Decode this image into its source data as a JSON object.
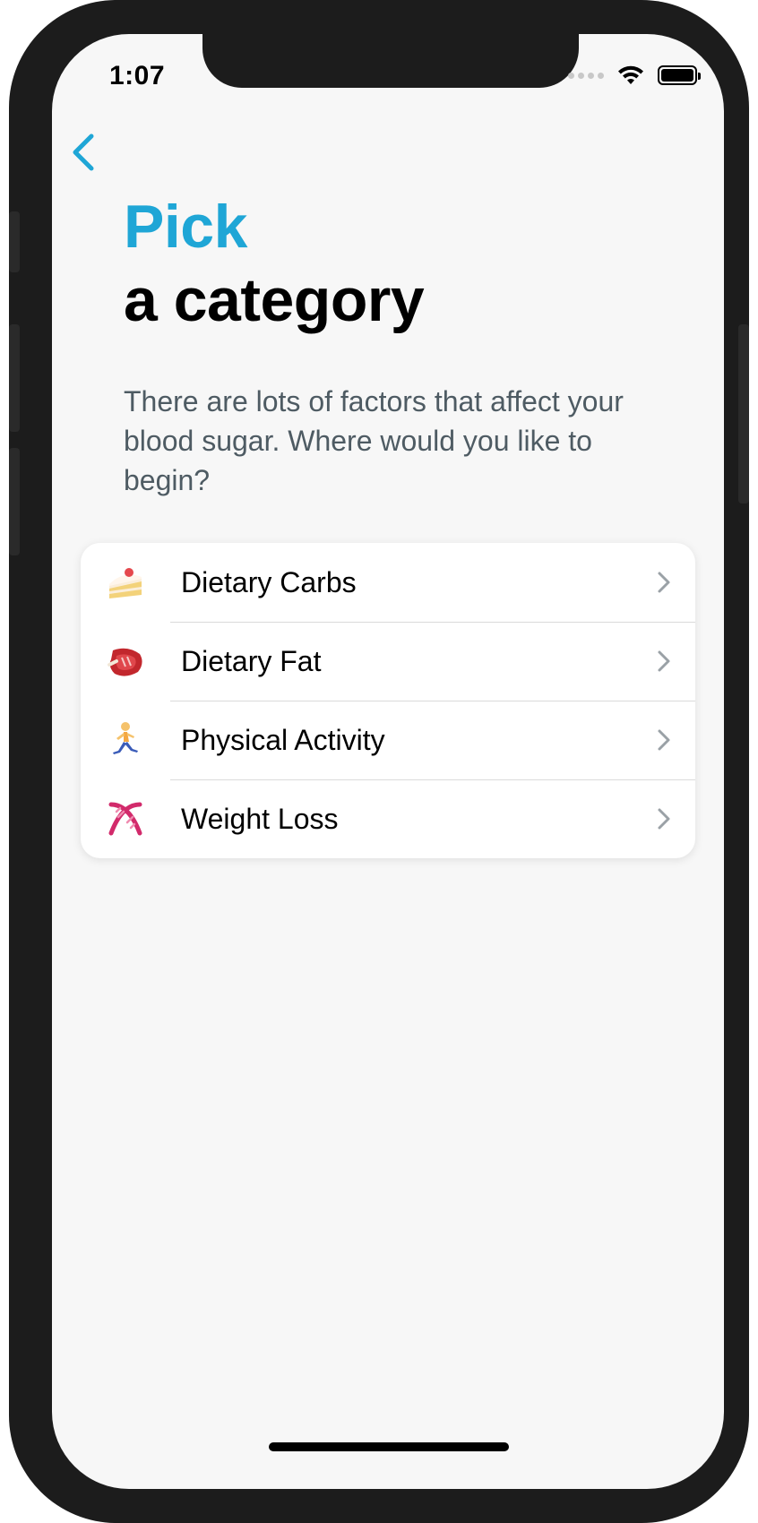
{
  "status_bar": {
    "time": "1:07"
  },
  "header": {
    "title_accent": "Pick",
    "title": "a category",
    "subtitle": "There are lots of factors that affect your blood sugar. Where would you like to begin?"
  },
  "categories": [
    {
      "label": "Dietary Carbs",
      "icon": "cake-icon"
    },
    {
      "label": "Dietary Fat",
      "icon": "steak-icon"
    },
    {
      "label": "Physical Activity",
      "icon": "runner-icon"
    },
    {
      "label": "Weight Loss",
      "icon": "dna-icon"
    }
  ],
  "colors": {
    "accent": "#1fa6d6",
    "subtitle": "#4e5b63",
    "background": "#f7f7f7"
  }
}
